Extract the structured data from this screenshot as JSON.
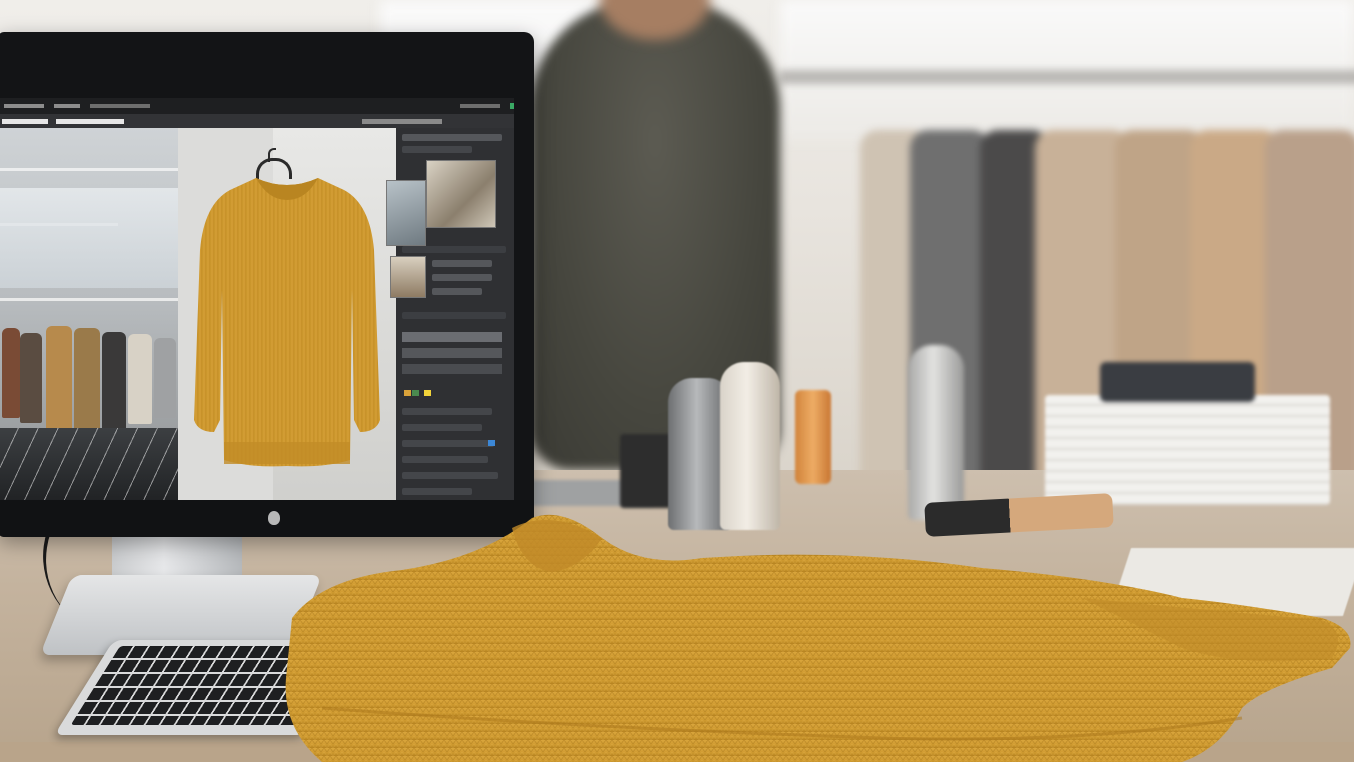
{
  "image": {
    "description_colors": {
      "sweater": "#d8a43a",
      "sweater_shadow": "#a9781f",
      "monitor_bezel": "#131416",
      "table": "#c4b39e",
      "wall": "#ece9e3",
      "app_dark": "#2a2b2e"
    }
  },
  "screen": {
    "app_panels": [
      "menubar",
      "options-bar",
      "reference-panel",
      "canvas",
      "layers-panel",
      "statusbar"
    ],
    "icons": [
      "hanger-icon",
      "apple-logo-icon"
    ]
  }
}
